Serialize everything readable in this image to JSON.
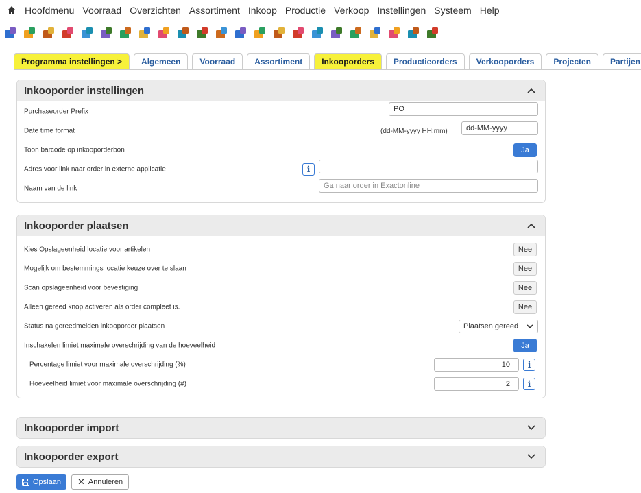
{
  "menu": {
    "home_icon": "home-icon",
    "items": [
      "Hoofdmenu",
      "Voorraad",
      "Overzichten",
      "Assortiment",
      "Inkoop",
      "Productie",
      "Verkoop",
      "Instellingen",
      "Systeem",
      "Help"
    ]
  },
  "toolbar": {
    "icons": [
      "phone-icon",
      "folder-icon",
      "tools-icon",
      "boxes-icon",
      "scanner-icon",
      "grid-box-icon",
      "cube-icon",
      "pallet-icon",
      "box-add-icon",
      "box-add-2-icon",
      "search-box-icon",
      "search-box-2-icon",
      "box-check-icon",
      "box-refresh-icon",
      "box-document-icon",
      "box-send-icon",
      "box-doc-2-icon",
      "box-user-icon",
      "box-up-icon",
      "box-down-icon",
      "box-arrow-icon",
      "box-share-icon",
      "box-person-icon"
    ]
  },
  "tabs": [
    {
      "label": "Programma instellingen >",
      "highlight": true
    },
    {
      "label": "Algemeen",
      "highlight": false
    },
    {
      "label": "Voorraad",
      "highlight": false
    },
    {
      "label": "Assortiment",
      "highlight": false
    },
    {
      "label": "Inkooporders",
      "highlight": true
    },
    {
      "label": "Productieorders",
      "highlight": false
    },
    {
      "label": "Verkooporders",
      "highlight": false
    },
    {
      "label": "Projecten",
      "highlight": false
    },
    {
      "label": "Partijen",
      "highlight": false
    }
  ],
  "panel1": {
    "title": "Inkooporder instellingen",
    "rows": {
      "prefix_label": "Purchaseorder Prefix",
      "prefix_value": "PO",
      "datetime_label": "Date time format",
      "datetime_hint": "(dd-MM-yyyy HH:mm)",
      "datetime_value": "dd-MM-yyyy",
      "barcode_label": "Toon barcode op inkooporderbon",
      "barcode_value": "Ja",
      "link_label": "Adres voor link naar order in externe applicatie",
      "link_value": "",
      "linkname_label": "Naam van de link",
      "linkname_placeholder": "Ga naar order in Exactonline"
    }
  },
  "panel2": {
    "title": "Inkooporder plaatsen",
    "rows": {
      "loc_label": "Kies Opslageenheid locatie voor artikelen",
      "loc_value": "Nee",
      "skip_label": "Mogelijk om bestemmings locatie keuze over te slaan",
      "skip_value": "Nee",
      "scan_label": "Scan opslageenheid voor bevestiging",
      "scan_value": "Nee",
      "complete_label": "Alleen gereed knop activeren als order compleet is.",
      "complete_value": "Nee",
      "status_label": "Status na gereedmelden inkooporder plaatsen",
      "status_value": "Plaatsen gereed",
      "limit_label": "Inschakelen limiet maximale overschrijding van de hoeveelheid",
      "limit_value": "Ja",
      "pct_label": "Percentage limiet voor maximale overschrijding (%)",
      "pct_value": "10",
      "qty_label": "Hoeveelheid limiet voor maximale overschrijding (#)",
      "qty_value": "2"
    }
  },
  "panel3": {
    "title": "Inkooporder import"
  },
  "panel4": {
    "title": "Inkooporder export"
  },
  "footer": {
    "save_label": "Opslaan",
    "cancel_label": "Annuleren"
  },
  "colors": {
    "accent": "#3a7bd5",
    "highlight": "#f7f13a",
    "tab_text": "#2a5d9f"
  }
}
